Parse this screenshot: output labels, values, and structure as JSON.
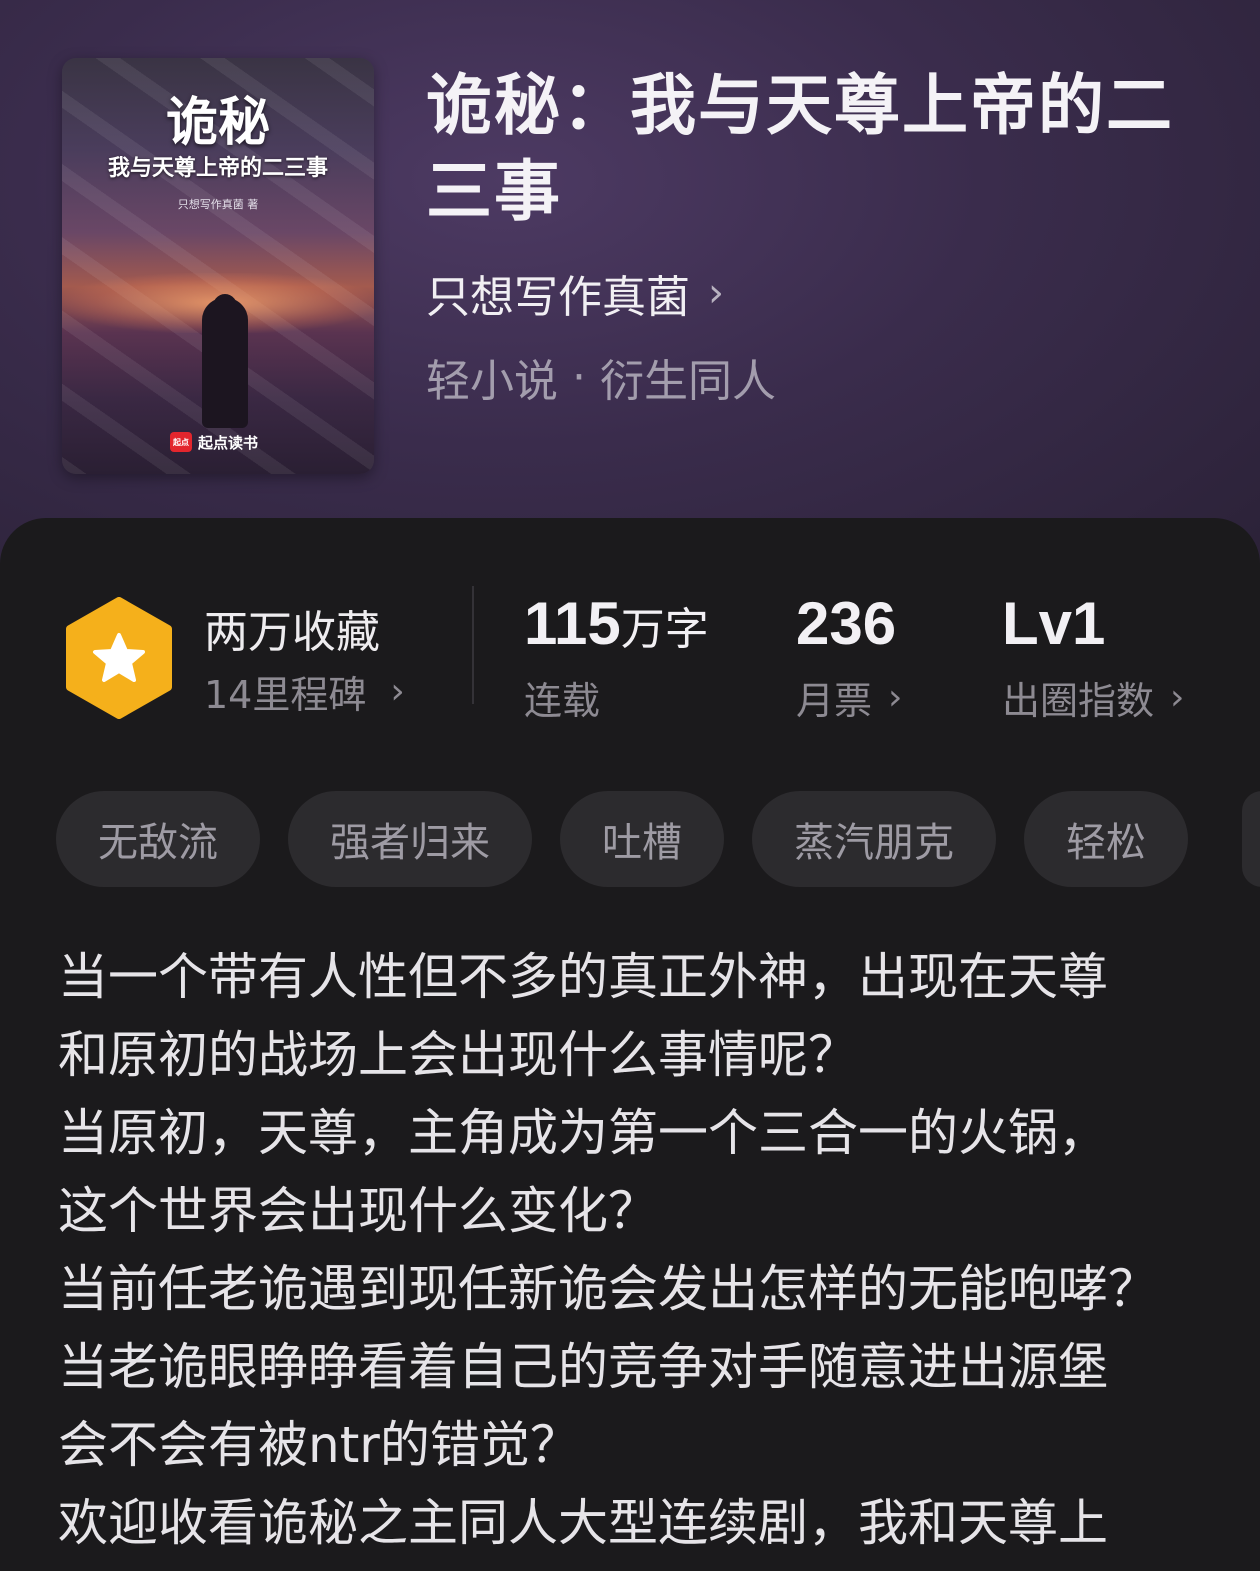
{
  "book": {
    "cover": {
      "title": "诡秘",
      "subtitle": "我与天尊上帝的二三事",
      "author_line": "只想写作真菌 著",
      "logo_badge": "起点",
      "logo_text": "起点读书"
    },
    "title": "诡秘：我与天尊上帝的二三事",
    "author": "只想写作真菌",
    "category": "轻小说",
    "subcategory": "衍生同人"
  },
  "stats": {
    "collection": {
      "main": "两万收藏",
      "sub": "14里程碑"
    },
    "words": {
      "number": "115",
      "unit": "万字",
      "label": "连载"
    },
    "monthly_ticket": {
      "number": "236",
      "label": "月票"
    },
    "index": {
      "number": "Lv1",
      "label": "出圈指数"
    }
  },
  "tags": [
    "无敌流",
    "强者归来",
    "吐槽",
    "蒸汽朋克",
    "轻松"
  ],
  "description": [
    "当一个带有人性但不多的真正外神，出现在天尊",
    "和原初的战场上会出现什么事情呢？",
    "当原初，天尊，主角成为第一个三合一的火锅，",
    "这个世界会出现什么变化？",
    "当前任老诡遇到现任新诡会发出怎样的无能咆哮？",
    "当老诡眼睁睁看着自己的竞争对手随意进出源堡",
    "会不会有被ntr的错觉？",
    "欢迎收看诡秘之主同人大型连续剧，我和天尊上"
  ],
  "icons": {
    "badge": "star-hexagon-icon",
    "chevron": "chevron-right-icon"
  },
  "colors": {
    "hero_bg": "#3a2c4c",
    "panel_bg": "#1b1a1c",
    "badge": "#f5b01b",
    "tag_bg": "#2c2b2e"
  }
}
